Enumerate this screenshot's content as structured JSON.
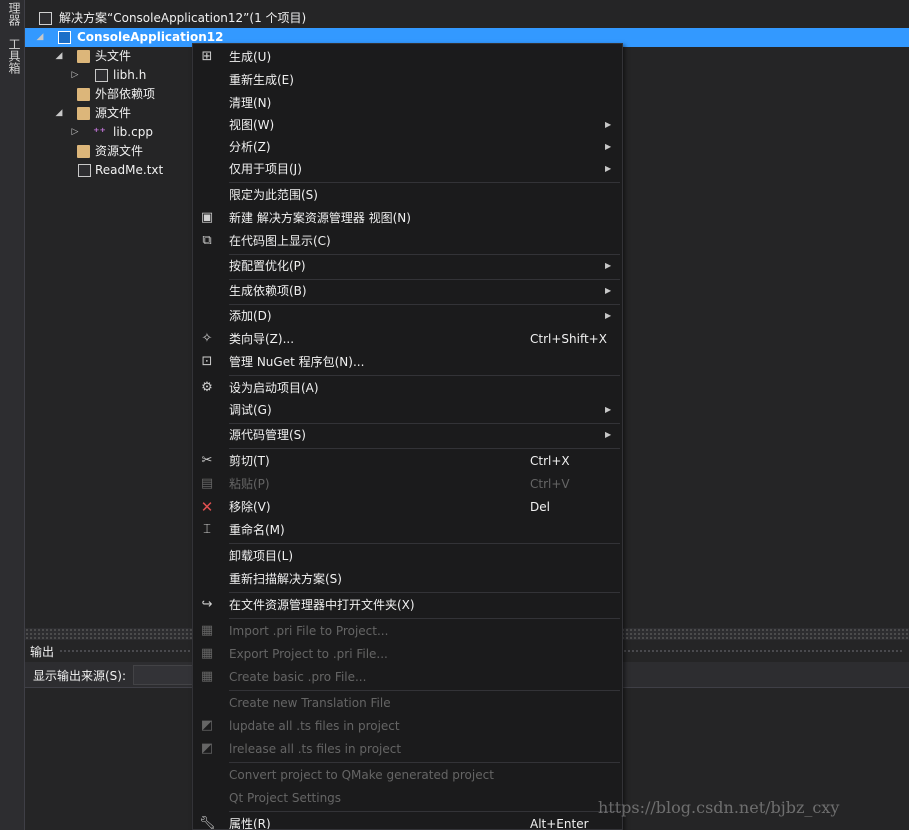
{
  "side_strip": {
    "tab1": "理器",
    "tab2": "工具箱"
  },
  "explorer": {
    "solution_label": "解决方案“ConsoleApplication12”(1 个项目)",
    "project_label": "ConsoleApplication12",
    "items": [
      {
        "label": "头文件",
        "icon": "folder-icon"
      },
      {
        "label": "libh.h",
        "icon": "header-file-icon"
      },
      {
        "label": "外部依赖项",
        "icon": "external-deps-icon"
      },
      {
        "label": "源文件",
        "icon": "folder-icon"
      },
      {
        "label": "lib.cpp",
        "icon": "cpp-file-icon"
      },
      {
        "label": "资源文件",
        "icon": "folder-icon"
      },
      {
        "label": "ReadMe.txt",
        "icon": "text-file-icon"
      }
    ]
  },
  "output": {
    "title": "输出",
    "source_label": "显示输出来源(S):"
  },
  "menu": {
    "items": [
      {
        "label": "生成(U)",
        "icon": "build-icon"
      },
      {
        "label": "重新生成(E)"
      },
      {
        "label": "清理(N)"
      },
      {
        "label": "视图(W)",
        "submenu": true
      },
      {
        "label": "分析(Z)",
        "submenu": true
      },
      {
        "label": "仅用于项目(J)",
        "submenu": true
      },
      {
        "label": "限定为此范围(S)"
      },
      {
        "label": "新建 解决方案资源管理器 视图(N)",
        "icon": "new-view-icon"
      },
      {
        "label": "在代码图上显示(C)",
        "icon": "code-map-icon"
      },
      {
        "label": "按配置优化(P)",
        "submenu": true
      },
      {
        "label": "生成依赖项(B)",
        "submenu": true
      },
      {
        "label": "添加(D)",
        "submenu": true
      },
      {
        "label": "类向导(Z)...",
        "shortcut": "Ctrl+Shift+X",
        "icon": "class-wizard-icon"
      },
      {
        "label": "管理 NuGet 程序包(N)...",
        "icon": "nuget-icon"
      },
      {
        "label": "设为启动项目(A)",
        "icon": "gear-icon"
      },
      {
        "label": "调试(G)",
        "submenu": true
      },
      {
        "label": "源代码管理(S)",
        "submenu": true
      },
      {
        "label": "剪切(T)",
        "shortcut": "Ctrl+X",
        "icon": "scissors-icon"
      },
      {
        "label": "粘贴(P)",
        "shortcut": "Ctrl+V",
        "icon": "paste-icon",
        "disabled": true
      },
      {
        "label": "移除(V)",
        "shortcut": "Del",
        "icon": "remove-icon"
      },
      {
        "label": "重命名(M)",
        "icon": "rename-icon"
      },
      {
        "label": "卸载项目(L)"
      },
      {
        "label": "重新扫描解决方案(S)"
      },
      {
        "label": "在文件资源管理器中打开文件夹(X)",
        "icon": "open-folder-icon"
      },
      {
        "label": "Import .pri File to Project...",
        "icon": "import-icon",
        "disabled": true
      },
      {
        "label": "Export Project to .pri File...",
        "icon": "export-icon",
        "disabled": true
      },
      {
        "label": "Create basic .pro File...",
        "icon": "pro-file-icon",
        "disabled": true
      },
      {
        "label": "Create new Translation File",
        "disabled": true
      },
      {
        "label": "lupdate all .ts files in project",
        "icon": "lupdate-icon",
        "disabled": true
      },
      {
        "label": "lrelease all .ts files in project",
        "icon": "lrelease-icon",
        "disabled": true
      },
      {
        "label": "Convert project to QMake generated project",
        "disabled": true
      },
      {
        "label": "Qt Project Settings",
        "disabled": true
      },
      {
        "label": "属性(R)",
        "shortcut": "Alt+Enter",
        "icon": "wrench-icon"
      }
    ]
  },
  "watermark": "https://blog.csdn.net/bjbz_cxy",
  "colors": {
    "selection": "#3399ff",
    "menu_bg": "#1b1b1c",
    "disabled_text": "#656565",
    "remove_icon": "#e05050"
  }
}
